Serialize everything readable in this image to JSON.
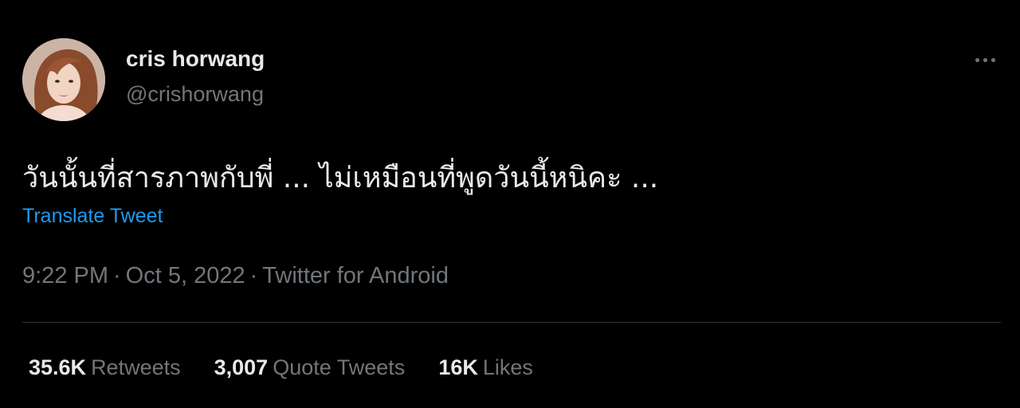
{
  "user": {
    "display_name": "cris horwang",
    "handle": "@crishorwang"
  },
  "tweet": {
    "text": "วันนั้นที่สารภาพกับพี่ ... ไม่เหมือนที่พูดวันนี้หนิคะ ...",
    "translate_label": "Translate Tweet",
    "time": "9:22 PM",
    "date": "Oct 5, 2022",
    "source": "Twitter for Android",
    "separator": "·"
  },
  "stats": {
    "retweets_count": "35.6K",
    "retweets_label": "Retweets",
    "quotes_count": "3,007",
    "quotes_label": "Quote Tweets",
    "likes_count": "16K",
    "likes_label": "Likes"
  },
  "icons": {
    "more": "more-horizontal-icon"
  },
  "colors": {
    "background": "#000000",
    "primary_text": "#e7e9ea",
    "secondary_text": "#71767b",
    "link": "#1d9bf0",
    "divider": "#2f3336"
  }
}
